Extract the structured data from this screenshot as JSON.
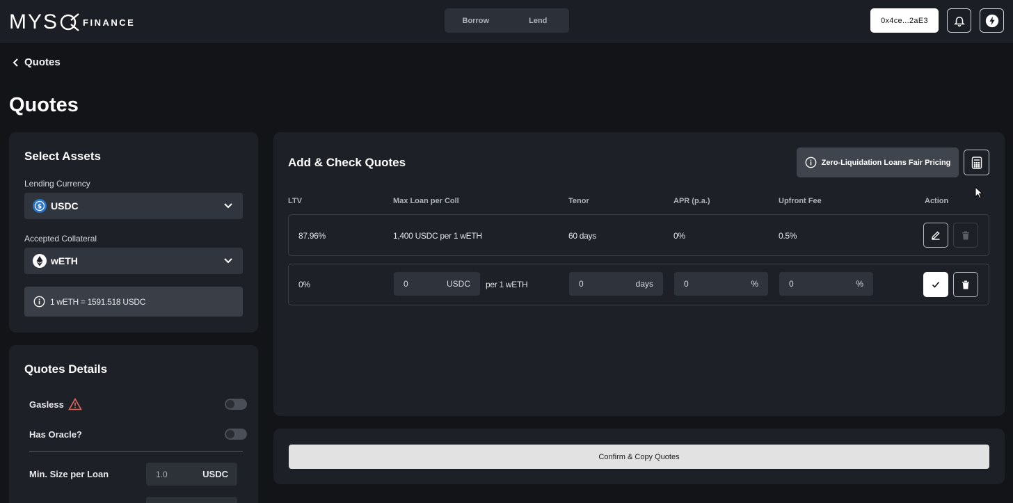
{
  "brand": {
    "wordmark": "MYS",
    "suffix": "FINANCE"
  },
  "nav": {
    "tabs": [
      {
        "label": "Borrow"
      },
      {
        "label": "Lend"
      }
    ]
  },
  "header": {
    "wallet": "0x4ce...2aE3"
  },
  "breadcrumb": {
    "back_label": "Quotes"
  },
  "page": {
    "title": "Quotes"
  },
  "assets": {
    "title": "Select Assets",
    "lending_currency_label": "Lending Currency",
    "lending_currency": "USDC",
    "collateral_label": "Accepted Collateral",
    "collateral": "wETH",
    "rate_text": "1 wETH = 1591.518 USDC"
  },
  "details": {
    "title": "Quotes Details",
    "gasless_label": "Gasless",
    "oracle_label": "Has Oracle?",
    "min_size_label": "Min. Size per Loan",
    "min_size_value": "1.0",
    "min_size_unit": "USDC"
  },
  "quotes": {
    "title": "Add & Check Quotes",
    "pricing_button": "Zero-Liquidation Loans Fair Pricing",
    "columns": [
      "LTV",
      "Max Loan per Coll",
      "Tenor",
      "APR (p.a.)",
      "Upfront Fee",
      "Action"
    ],
    "rows": [
      {
        "ltv": "87.96%",
        "max_loan": "1,400 USDC per 1 wETH",
        "tenor": "60 days",
        "apr": "0%",
        "fee": "0.5%"
      }
    ],
    "new_row": {
      "ltv": "0%",
      "max_loan_value": "0",
      "max_loan_unit": "USDC",
      "per_text": "per 1 wETH",
      "tenor_value": "0",
      "tenor_unit": "days",
      "apr_value": "0",
      "apr_unit": "%",
      "fee_value": "0",
      "fee_unit": "%"
    }
  },
  "confirm": {
    "label": "Confirm & Copy Quotes"
  },
  "colors": {
    "background": "#121418",
    "card": "#1d2026",
    "topbar": "#1b1e24",
    "usdc": "#2775ca"
  }
}
